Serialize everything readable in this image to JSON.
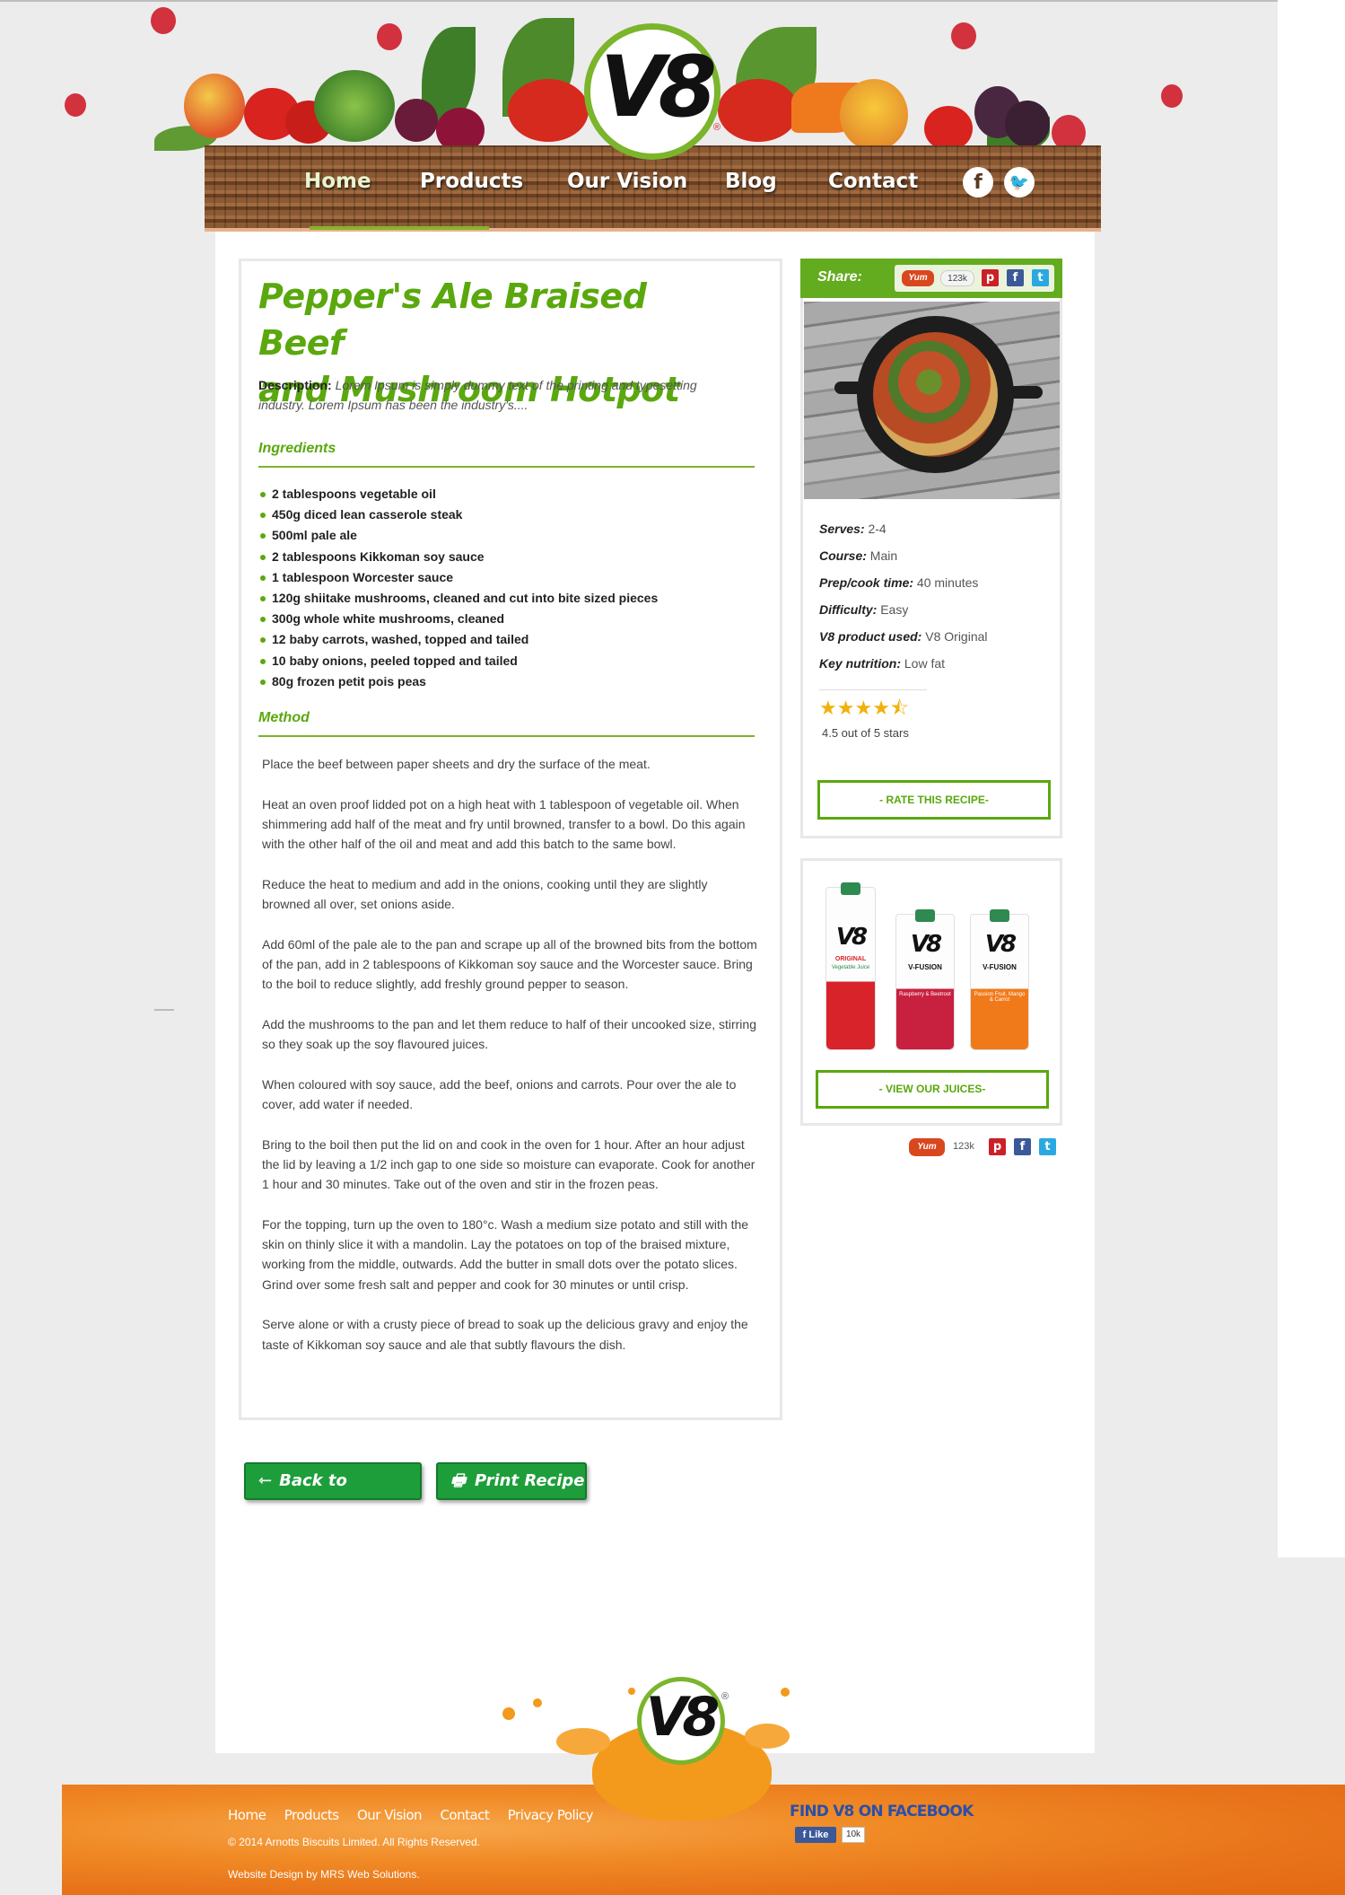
{
  "nav": {
    "items": [
      "Home",
      "Products",
      "Our Vision",
      "Blog",
      "Contact"
    ],
    "active": "Home",
    "social": [
      "facebook-icon",
      "twitter-icon"
    ]
  },
  "brand": {
    "logo_text": "V8",
    "registered": "®"
  },
  "recipe": {
    "title_line1": "Pepper's Ale Braised Beef",
    "title_line2": "and Mushroom Hotpot",
    "description_label": "Description:",
    "description_text": "Lorem Ipsum is simply dummy text of the printing and typesetting industry. Lorem Ipsum has been the industry's....",
    "ingredients_heading": "Ingredients",
    "ingredients": [
      "2 tablespoons vegetable oil",
      "450g diced lean casserole steak",
      "500ml pale ale",
      "2 tablespoons Kikkoman soy sauce",
      "1 tablespoon Worcester sauce",
      "120g shiitake mushrooms, cleaned and cut into bite sized pieces",
      "300g whole white mushrooms, cleaned",
      "12 baby carrots, washed, topped and tailed",
      "10 baby onions, peeled topped and tailed",
      "80g frozen petit pois peas"
    ],
    "method_heading": "Method",
    "method": [
      "Place the beef between paper sheets and dry the surface of the meat.",
      "Heat an oven proof lidded pot on a high heat with 1 tablespoon of vegetable oil. When shimmering add half of the meat and fry until browned, transfer to a bowl. Do this again with the other half of the oil and meat and add this batch to the same bowl.",
      "Reduce the heat to medium and add in the onions, cooking until they are slightly browned all over, set onions aside.",
      "Add 60ml of the pale ale to the pan and scrape up all of the browned bits from the bottom of the pan, add in 2 tablespoons of Kikkoman soy sauce and the Worcester sauce. Bring to the boil to reduce slightly, add freshly ground pepper to season.",
      "Add the mushrooms to the pan and let them reduce to half of their uncooked size, stirring so they soak up the soy flavoured juices.",
      "When coloured with soy sauce, add the beef, onions and carrots. Pour over the ale to cover, add water if needed.",
      "Bring to the boil then put the lid on and cook in the oven for 1 hour. After an hour adjust the lid by leaving a 1/2 inch gap to one side so moisture can evaporate. Cook for another 1 hour and 30 minutes. Take out of the oven and stir in the frozen peas.",
      "For the topping, turn up the oven to 180°c. Wash a medium size potato and still with the skin on thinly slice it with a mandolin. Lay the potatoes on top of the braised mixture, working from the middle, outwards. Add the butter in small dots over the potato slices. Grind over some fresh salt and pepper and cook for 30 minutes or until crisp.",
      "Serve alone or with a crusty piece of bread to soak up the delicious gravy and enjoy the taste of Kikkoman soy sauce and ale that subtly flavours the dish."
    ]
  },
  "share": {
    "label": "Share:",
    "yum": "Yum",
    "count": "123k",
    "icons": [
      "pinterest-icon",
      "facebook-icon",
      "twitter-icon"
    ],
    "glyphs": {
      "pinterest": "p",
      "facebook": "f",
      "twitter": "t"
    },
    "colors": {
      "pinterest": "#cb2027",
      "facebook": "#3b5998",
      "twitter": "#2aa9e0"
    }
  },
  "details": {
    "serves_label": "Serves:",
    "serves": "2-4",
    "course_label": "Course:",
    "course": "Main",
    "prep_label": "Prep/cook time:",
    "prep": "40 minutes",
    "difficulty_label": "Difficulty:",
    "difficulty": "Easy",
    "product_label": "V8 product used:",
    "product": "V8 Original",
    "nutrition_label": "Key nutrition:",
    "nutrition": "Low fat"
  },
  "rating": {
    "value": 4.5,
    "max": 5,
    "text": "4.5 out of 5 stars"
  },
  "buttons": {
    "rate": "- RATE THIS RECIPE-",
    "view_juices": "- VIEW OUR JUICES-",
    "back": "Back to Recipes",
    "print": "Print Recipe"
  },
  "juices": [
    {
      "brand": "V8",
      "line1": "ORIGINAL",
      "line2": "Vegetable Juice",
      "color": "#d8232a"
    },
    {
      "brand": "V8",
      "line1": "V-FUSION",
      "line2": "Raspberry & Beetroot",
      "color": "#c8203f"
    },
    {
      "brand": "V8",
      "line1": "V-FUSION",
      "line2": "Passion Fruit, Mango & Carrot",
      "color": "#f07a1a"
    }
  ],
  "footer": {
    "links": [
      "Home",
      "Products",
      "Our Vision",
      "Contact",
      "Privacy Policy"
    ],
    "copyright": "© 2014 Arnotts Biscuits Limited. All Rights Reserved.",
    "credit": "Website Design by MRS Web Solutions.",
    "fb_find": "FIND V8 ON FACEBOOK",
    "fb_like": "Like",
    "fb_count": "10k"
  },
  "colors": {
    "accent_green": "#5aa80e",
    "button_green": "#1e9e3b",
    "footer_orange": "#f08a25"
  }
}
